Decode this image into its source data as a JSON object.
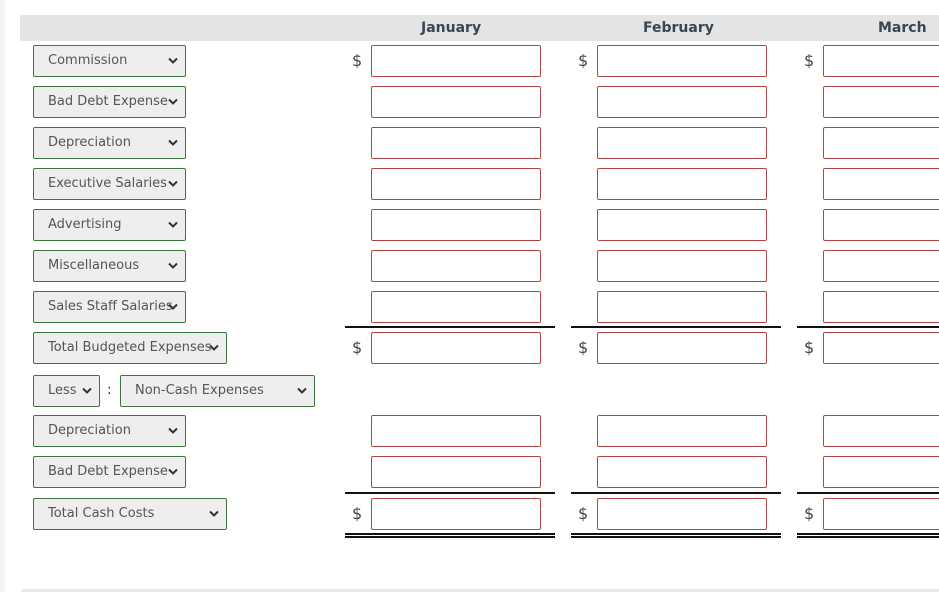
{
  "header": {
    "months": [
      "January",
      "February",
      "March"
    ]
  },
  "rows": [
    {
      "label": "Commission",
      "has_dollar": true
    },
    {
      "label": "Bad Debt Expense",
      "has_dollar": false
    },
    {
      "label": "Depreciation",
      "has_dollar": false
    },
    {
      "label": "Executive Salaries",
      "has_dollar": false
    },
    {
      "label": "Advertising",
      "has_dollar": false
    },
    {
      "label": "Miscellaneous",
      "has_dollar": false
    },
    {
      "label": "Sales Staff Salaries",
      "has_dollar": false
    },
    {
      "label": "Total Budgeted Expenses",
      "has_dollar": true
    },
    {
      "label": "Less",
      "sublabel": "Non-Cash Expenses",
      "separator": ":"
    },
    {
      "label": "Depreciation",
      "has_dollar": false
    },
    {
      "label": "Bad Debt Expense",
      "has_dollar": false
    },
    {
      "label": "Total Cash Costs",
      "has_dollar": true
    }
  ],
  "currency_symbol": "$",
  "input_values": {
    "january": [
      "",
      "",
      "",
      "",
      "",
      "",
      "",
      "",
      "",
      "",
      ""
    ],
    "february": [
      "",
      "",
      "",
      "",
      "",
      "",
      "",
      "",
      "",
      "",
      ""
    ],
    "march": [
      "",
      "",
      "",
      "",
      "",
      "",
      "",
      "",
      "",
      "",
      ""
    ]
  },
  "colors": {
    "select_border": "#3c763d",
    "input_border": "#b04545",
    "header_bg": "#e4e4e4"
  }
}
